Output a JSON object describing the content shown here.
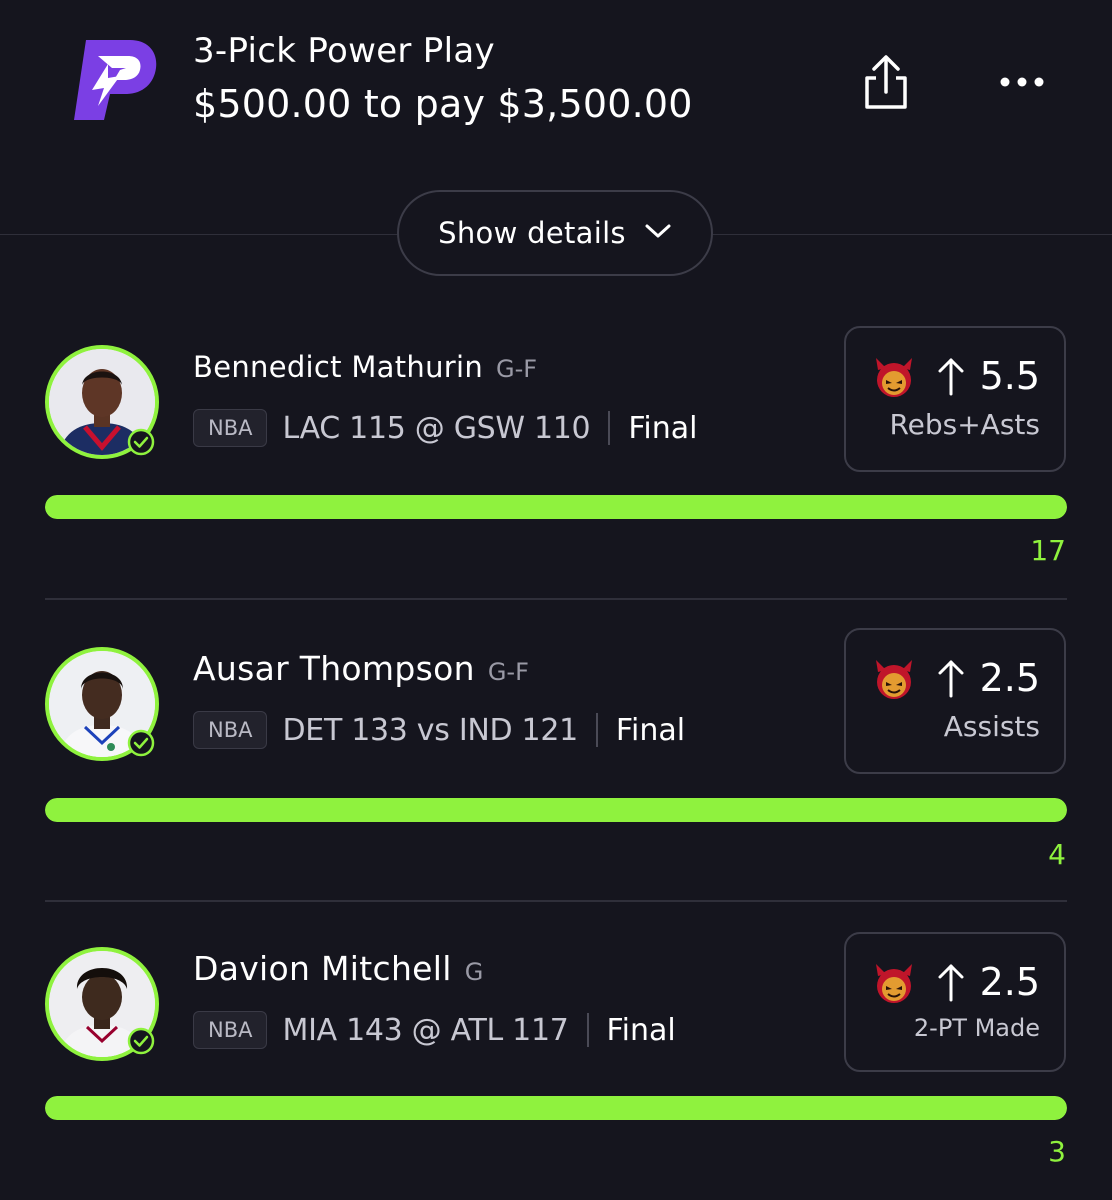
{
  "header": {
    "title": "3-Pick Power Play",
    "subtitle": "$500.00 to pay $3,500.00",
    "brand_color": "#7b3fe4",
    "share_icon": "share-icon",
    "more_icon": "more-horizontal-icon"
  },
  "details_button": {
    "label": "Show details",
    "icon": "chevron-down-icon"
  },
  "picks": [
    {
      "player": "Bennedict Mathurin",
      "position": "G-F",
      "league": "NBA",
      "game": "LAC 115 @ GSW 110",
      "status": "Final",
      "line": "5.5",
      "direction": "up",
      "stat_type": "Rebs+Asts",
      "actual": "17",
      "progress": 1.0
    },
    {
      "player": "Ausar Thompson",
      "position": "G-F",
      "league": "NBA",
      "game": "DET 133 vs IND 121",
      "status": "Final",
      "line": "2.5",
      "direction": "up",
      "stat_type": "Assists",
      "actual": "4",
      "progress": 1.0
    },
    {
      "player": "Davion Mitchell",
      "position": "G",
      "league": "NBA",
      "game": "MIA 143 @ ATL 117",
      "status": "Final",
      "line": "2.5",
      "direction": "up",
      "stat_type": "2-PT Made",
      "actual": "3",
      "progress": 1.0
    }
  ],
  "colors": {
    "background": "#15151e",
    "accent_green": "#8ff23e",
    "border": "#3c3c48"
  }
}
